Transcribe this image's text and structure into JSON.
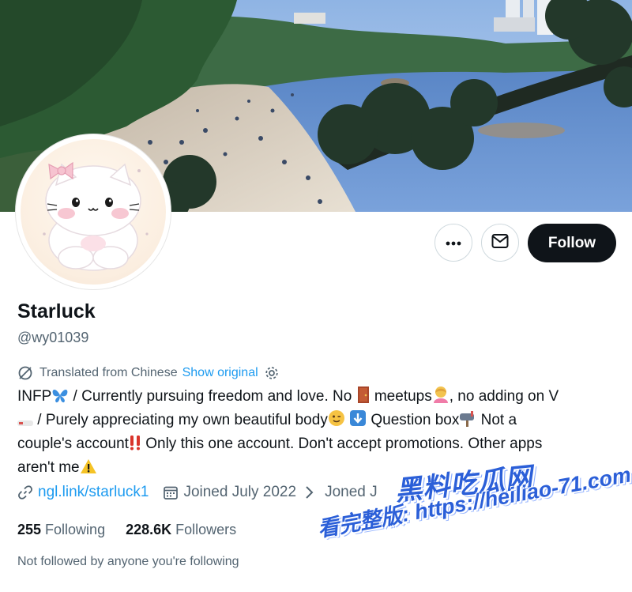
{
  "profile": {
    "display_name": "Starluck",
    "handle": "@wy01039"
  },
  "actions": {
    "follow_label": "Follow",
    "more_icon": "more-horizontal-icon",
    "message_icon": "envelope-icon"
  },
  "translation": {
    "notice": "Translated from Chinese",
    "show_original": "Show original"
  },
  "bio": {
    "line1_a": "INFP",
    "line1_b": " / Currently pursuing freedom and love. No",
    "line1_c": " meetups",
    "line1_d": ", no adding on V",
    "line2_a": " / Purely appreciating my own beautiful body",
    "line2_b": " Question box",
    "line2_c": " Not a",
    "line3_a": "couple's account",
    "line3_b": " Only this one account. Don't accept promotions. Other apps",
    "line4_a": "aren't me"
  },
  "meta": {
    "link_text": "ngl.link/starluck1",
    "joined_1": "Joined July 2022",
    "joined_2": "Joned J"
  },
  "stats": {
    "following_count": "255",
    "following_label": "Following",
    "followers_count": "228.6K",
    "followers_label": "Followers"
  },
  "not_followed": "Not followed by anyone you're following",
  "watermark": {
    "top": "黑料吃瓜网",
    "bottom": "看完整版: https://heiliao-71.com"
  },
  "colors": {
    "accent": "#1d9bf0",
    "text": "#0f1419",
    "secondary": "#536471",
    "follow_bg": "#0f1419",
    "watermark": "#2b5fd8"
  }
}
